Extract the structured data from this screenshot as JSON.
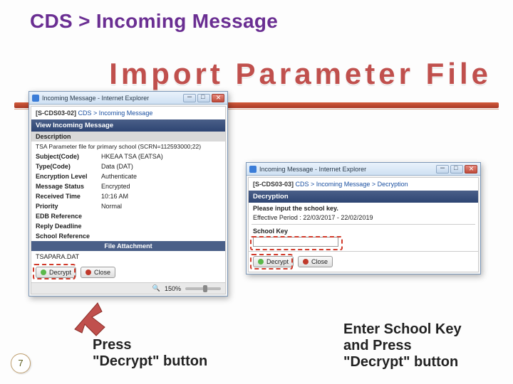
{
  "breadcrumb": "CDS > Incoming Message",
  "slide_title": "Import Parameter File",
  "page_number": "7",
  "win1": {
    "title": "Incoming Message - Internet Explorer",
    "crumb_code": "[S-CDS03-02]",
    "crumb_link": "CDS > Incoming Message",
    "section": "View Incoming Message",
    "desc_label": "Description",
    "desc_value": "TSA Parameter file for primary school (SCRN=112593000;22)",
    "rows": [
      {
        "k": "Subject(Code)",
        "v": "HKEAA TSA (EATSA)"
      },
      {
        "k": "Type(Code)",
        "v": "Data (DAT)"
      },
      {
        "k": "Encryption Level",
        "v": "Authenticate"
      },
      {
        "k": "Message Status",
        "v": "Encrypted"
      },
      {
        "k": "Received Time",
        "v": "10:16 AM"
      },
      {
        "k": "Priority",
        "v": "Normal"
      },
      {
        "k": "EDB Reference",
        "v": ""
      },
      {
        "k": "Reply Deadline",
        "v": ""
      },
      {
        "k": "School Reference",
        "v": ""
      }
    ],
    "attachment_header": "File Attachment",
    "attachment": "TSAPARA.DAT",
    "decrypt": "Decrypt",
    "close": "Close",
    "zoom": "150%"
  },
  "win2": {
    "title": "Incoming Message - Internet Explorer",
    "crumb_code": "[S-CDS03-03]",
    "crumb_link": "CDS > Incoming Message > Decryption",
    "section": "Decryption",
    "prompt": "Please input the school key.",
    "effective": "Effective Period : 22/03/2017 - 22/02/2019",
    "keylabel": "School Key",
    "decrypt": "Decrypt",
    "close": "Close"
  },
  "caption_left_1": "Press",
  "caption_left_2": "\"Decrypt\" button",
  "caption_right_1": "Enter School Key",
  "caption_right_2": "and Press",
  "caption_right_3": "\"Decrypt\" button"
}
